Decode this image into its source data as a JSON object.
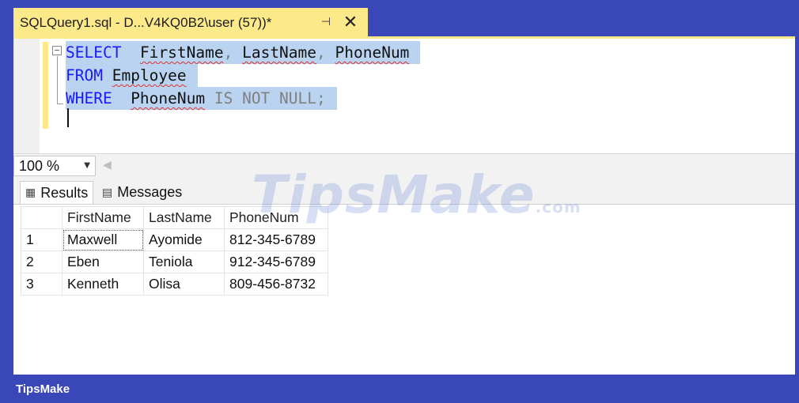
{
  "tab": {
    "title": "SQLQuery1.sql - D...V4KQ0B2\\user (57))*",
    "pin_icon": "pin-icon",
    "close_icon": "close-icon"
  },
  "editor": {
    "line1": {
      "kw": "SELECT",
      "col1": "FirstName",
      "sep1": ", ",
      "col2": "LastName",
      "sep2": ", ",
      "col3": "PhoneNum"
    },
    "line2": {
      "kw": "FROM",
      "table": "Employee"
    },
    "line3": {
      "kw": "WHERE",
      "col": "PhoneNum",
      "cond": "IS NOT NULL;"
    }
  },
  "zoom": {
    "value": "100 %"
  },
  "result_tabs": [
    {
      "label": "Results",
      "icon": "grid-icon"
    },
    {
      "label": "Messages",
      "icon": "messages-icon"
    }
  ],
  "results": {
    "columns": [
      "FirstName",
      "LastName",
      "PhoneNum"
    ],
    "rows": [
      {
        "num": "1",
        "FirstName": "Maxwell",
        "LastName": "Ayomide",
        "PhoneNum": "812-345-6789"
      },
      {
        "num": "2",
        "FirstName": "Eben",
        "LastName": "Teniola",
        "PhoneNum": "912-345-6789"
      },
      {
        "num": "3",
        "FirstName": "Kenneth",
        "LastName": "Olisa",
        "PhoneNum": "809-456-8732"
      }
    ]
  },
  "watermark": {
    "text": "TipsMake",
    "suffix": ".com"
  },
  "footer": {
    "brand": "TipsMake"
  }
}
